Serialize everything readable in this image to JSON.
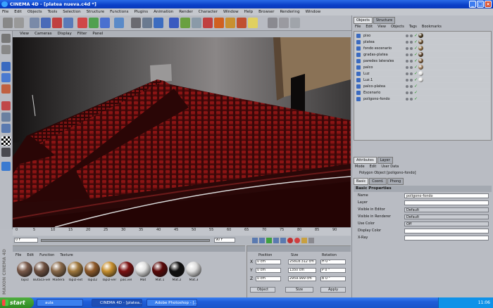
{
  "window": {
    "title": "CINEMA 4D - [platea nueva.c4d *]",
    "controls": [
      "_",
      "□",
      "×"
    ]
  },
  "menu": [
    "File",
    "Edit",
    "Objects",
    "Tools",
    "Selection",
    "Structure",
    "Functions",
    "Plugins",
    "Animation",
    "Render",
    "Character",
    "Window",
    "Help",
    "Browser",
    "Rendering",
    "Window"
  ],
  "viewport": {
    "menu": [
      "View",
      "Cameras",
      "Display",
      "Filter",
      "Panel"
    ]
  },
  "timeline": {
    "ticks": [
      "0",
      "5",
      "10",
      "15",
      "20",
      "25",
      "30",
      "35",
      "40",
      "45",
      "50",
      "55",
      "60",
      "65",
      "70",
      "75",
      "80",
      "85",
      "90"
    ],
    "end_label": "0 F"
  },
  "transport": {
    "current_frame": "0 F",
    "end_frame": "90 F"
  },
  "materials": {
    "menu": [
      "File",
      "Edit",
      "Function",
      "Texture"
    ],
    "items": [
      {
        "label": "Tapiz",
        "color": "#7a5a4a"
      },
      {
        "label": "Butaca-vel",
        "color": "#6e5040"
      },
      {
        "label": "Madera",
        "color": "#8a6a4a"
      },
      {
        "label": "Tapiz-ext",
        "color": "#a0783c"
      },
      {
        "label": "Tapiz2",
        "color": "#8e5a2a"
      },
      {
        "label": "Tapiz-ver",
        "color": "#c8902e"
      },
      {
        "label": "pas.vel",
        "color": "#7a1010"
      },
      {
        "label": "Mat",
        "color": "#e0e0e0"
      },
      {
        "label": "Mat.1",
        "color": "#5a0808"
      },
      {
        "label": "Mat.2",
        "color": "#101010"
      },
      {
        "label": "Mat.3",
        "color": "#dcdcdc"
      }
    ]
  },
  "coordinates": {
    "headers": [
      "Position",
      "Size",
      "Rotation"
    ],
    "rows": [
      {
        "axis": "X",
        "pos": "0 cm",
        "size": "25818.312 cm",
        "rot": "H 0 °"
      },
      {
        "axis": "Y",
        "pos": "0 cm",
        "size": "1350 cm",
        "rot": "P 0 °"
      },
      {
        "axis": "Z",
        "pos": "0 cm",
        "size": "2959.999 cm",
        "rot": "B 0 °"
      }
    ],
    "mode1": "Object",
    "mode2": "Size",
    "apply": "Apply"
  },
  "objects": {
    "tabs": [
      "Objects",
      "Structure"
    ],
    "menu": [
      "File",
      "Edit",
      "View",
      "Objects",
      "Tags",
      "Bookmarks"
    ],
    "rows": [
      {
        "name": "piso",
        "ball": "#4a3a20"
      },
      {
        "name": "platea",
        "ball": "#6a5030"
      },
      {
        "name": "fondo escenario",
        "ball": "#8a6a40"
      },
      {
        "name": "gradas-platea",
        "ball": "#5a4028"
      },
      {
        "name": "paredes laterales",
        "ball": "#7a5a3a"
      },
      {
        "name": "palco",
        "ball": "#a08060"
      },
      {
        "name": "Luz",
        "ball": "#e0e0e0"
      },
      {
        "name": "Luz.1",
        "ball": "#e0e0e0"
      },
      {
        "name": "palco-platea",
        "ball": ""
      },
      {
        "name": "Escenario",
        "ball": ""
      },
      {
        "name": "poligono-fondo",
        "ball": ""
      }
    ]
  },
  "attributes": {
    "tabs": [
      "Attributes",
      "Layer"
    ],
    "menu": [
      "Mode",
      "Edit",
      "User Data"
    ],
    "object_title": "Polygon Object [poligono-fondo]",
    "subtabs": [
      "Basic",
      "Coord.",
      "Phong"
    ],
    "section": "Basic Properties",
    "fields": [
      {
        "label": "Name",
        "value": "poligono-fondo"
      },
      {
        "label": "Layer",
        "value": ""
      },
      {
        "label": "Visible in Editor",
        "value": "Default"
      },
      {
        "label": "Visible in Renderer",
        "value": "Default"
      },
      {
        "label": "Use Color",
        "value": "Off"
      },
      {
        "label": "Display Color",
        "value": ""
      },
      {
        "label": "X-Ray",
        "value": ""
      }
    ]
  },
  "taskbar": {
    "start": "start",
    "tasks": [
      "aula",
      "CINEMA 4D - [platea...",
      "Adobe Photoshop - [..."
    ],
    "clock": "11:06"
  }
}
